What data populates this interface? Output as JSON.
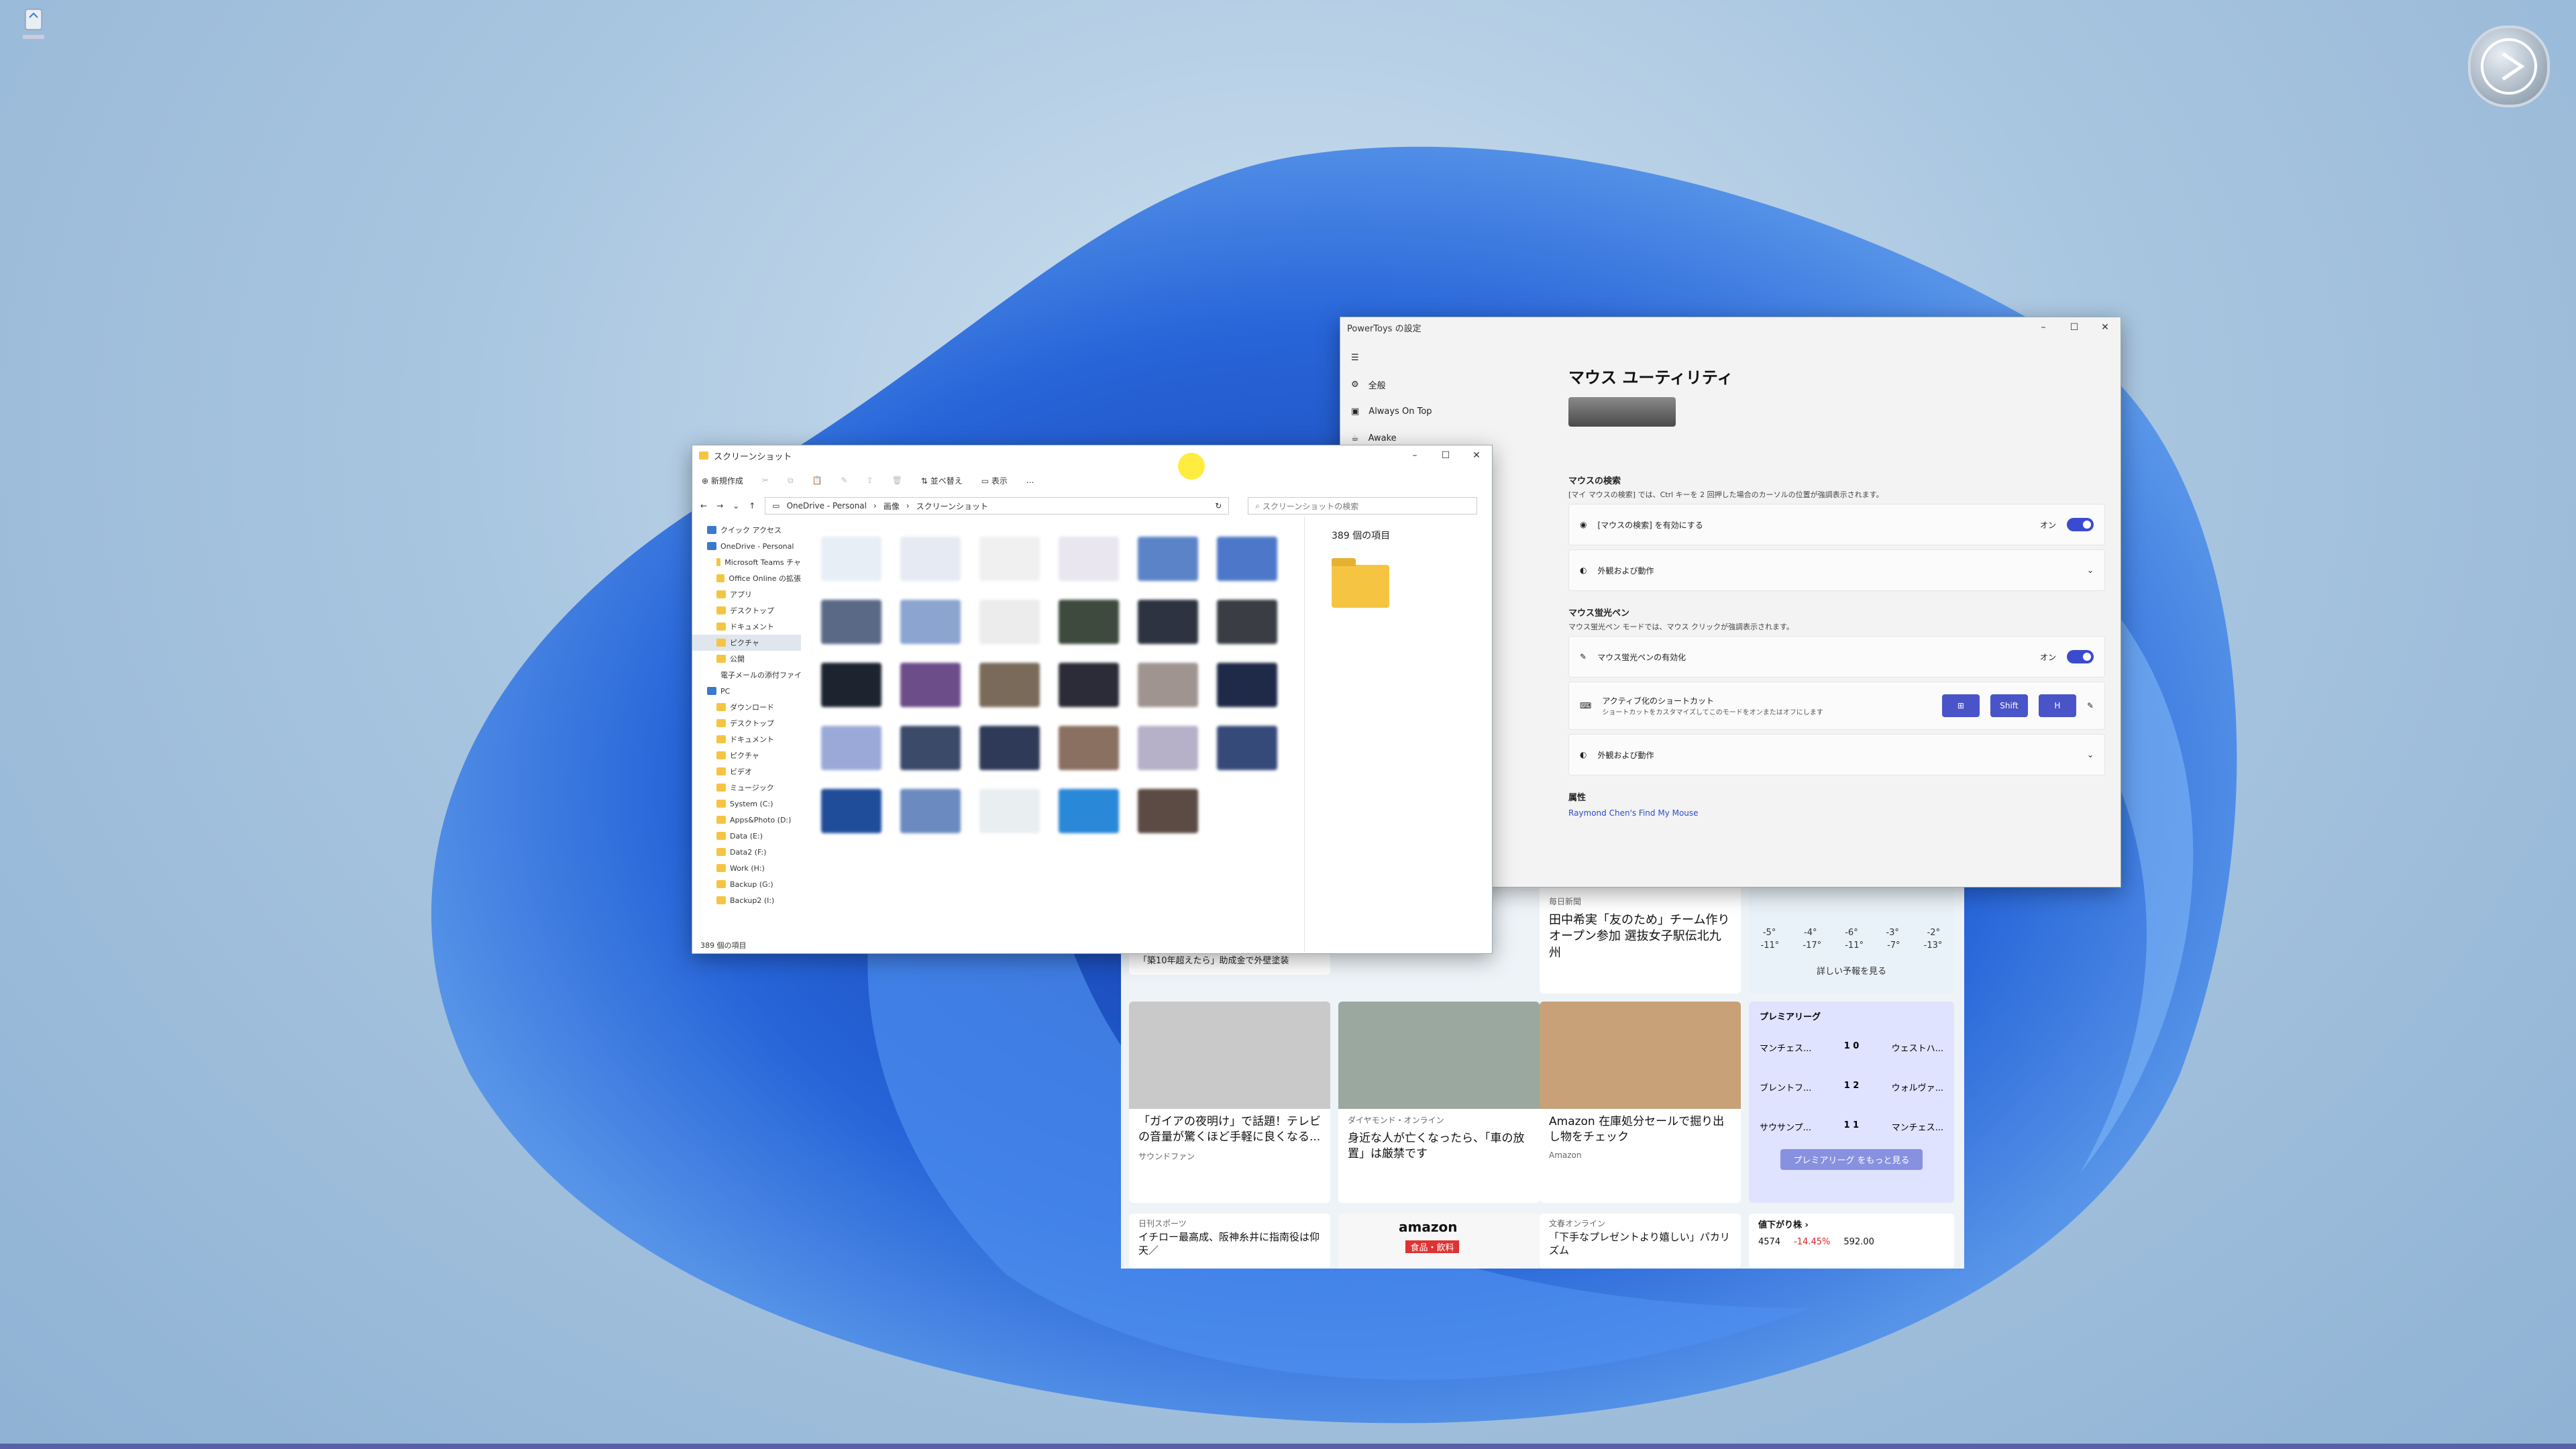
{
  "desktop": {
    "recycle_icon": "recycle-bin-icon"
  },
  "explorer": {
    "title": "スクリーンショット",
    "toolbar": {
      "new_label": "新規作成",
      "sort_label": "並べ替え",
      "view_label": "表示",
      "more_label": "..."
    },
    "breadcrumb": [
      "OneDrive - Personal",
      "画像",
      "スクリーンショット"
    ],
    "search_placeholder": "スクリーンショットの検索",
    "nav": [
      {
        "label": "クイック アクセス",
        "level": 0
      },
      {
        "label": "OneDrive - Personal",
        "level": 0
      },
      {
        "label": "Microsoft Teams チャ",
        "level": 1
      },
      {
        "label": "Office Online の拡張",
        "level": 1
      },
      {
        "label": "アプリ",
        "level": 1
      },
      {
        "label": "デスクトップ",
        "level": 1
      },
      {
        "label": "ドキュメント",
        "level": 1
      },
      {
        "label": "ピクチャ",
        "level": 1,
        "selected": true
      },
      {
        "label": "公開",
        "level": 1
      },
      {
        "label": "電子メールの添付ファイ",
        "level": 1
      },
      {
        "label": "PC",
        "level": 0
      },
      {
        "label": "ダウンロード",
        "level": 1
      },
      {
        "label": "デスクトップ",
        "level": 1
      },
      {
        "label": "ドキュメント",
        "level": 1
      },
      {
        "label": "ピクチャ",
        "level": 1
      },
      {
        "label": "ビデオ",
        "level": 1
      },
      {
        "label": "ミュージック",
        "level": 1
      },
      {
        "label": "System (C:)",
        "level": 1
      },
      {
        "label": "Apps&Photo (D:)",
        "level": 1
      },
      {
        "label": "Data (E:)",
        "level": 1
      },
      {
        "label": "Data2 (F:)",
        "level": 1
      },
      {
        "label": "Work (H:)",
        "level": 1
      },
      {
        "label": "Backup (G:)",
        "level": 1
      },
      {
        "label": "Backup2 (I:)",
        "level": 1
      }
    ],
    "item_count": "389 個の項目",
    "status_text": "389 個の項目",
    "thumb_colors": [
      "#e8eef6",
      "#e6ebf3",
      "#f0f0f0",
      "#e9e6ef",
      "#5b84c8",
      "#4d78c9",
      "#5a6a86",
      "#8ba5d0",
      "#ececec",
      "#3e4a3e",
      "#2d3340",
      "#3a3d44",
      "#1d2430",
      "#6d4c8a",
      "#7a6a5a",
      "#2c2c38",
      "#a09490",
      "#1e2a48",
      "#9ba9d8",
      "#3c4a6a",
      "#2e3a58",
      "#8a7060",
      "#b6b0c8",
      "#364a7a",
      "#1f4d9a",
      "#6a8ac0",
      "#e9eef0",
      "#2a88d8",
      "#5c4a44"
    ]
  },
  "powertoys": {
    "title": "PowerToys の設定",
    "nav": [
      {
        "label": "全般",
        "icon": "gear-icon"
      },
      {
        "label": "Always On Top",
        "icon": "window-icon"
      },
      {
        "label": "Awake",
        "icon": "coffee-icon"
      }
    ],
    "heading": "マウス ユーティリティ",
    "find_mouse": {
      "section": "マウスの検索",
      "desc": "[マイ マウスの検索] では、Ctrl キーを 2 回押した場合のカーソルの位置が強調表示されます。",
      "enable_label": "[マウスの検索] を有効にする",
      "state": "オン",
      "appearance": "外観および動作"
    },
    "highlighter": {
      "section": "マウス蛍光ペン",
      "desc": "マウス蛍光ペン モードでは、マウス クリックが強調表示されます。",
      "enable_label": "マウス蛍光ペンの有効化",
      "state": "オン",
      "shortcut_label": "アクティブ化のショートカット",
      "shortcut_desc": "ショートカットをカスタマイズしてこのモードをオンまたはオフにします",
      "keys": [
        "⊞",
        "Shift",
        "H"
      ],
      "appearance": "外観および動作"
    },
    "attribution": {
      "label": "属性",
      "link": "Raymond Chen's Find My Mouse"
    }
  },
  "news": {
    "top_left": "「築10年超えたら」助成金で外壁塗装",
    "top_mid_src": "毎日新聞",
    "top_mid": "田中希実「友のため」チーム作りオープン参加 選抜女子駅伝北九州",
    "weather": {
      "temps_high": [
        "-5°",
        "-4°",
        "-6°",
        "-3°",
        "-2°"
      ],
      "temps_low": [
        "-11°",
        "-17°",
        "-11°",
        "-7°",
        "-13°"
      ],
      "more": "詳しい予報を見る"
    },
    "cards": [
      {
        "headline": "「ガイアの夜明け」で話題！テレビの音量が驚くほど手軽に良くなる...",
        "source": "サウンドファン",
        "img": "#c9c9c9"
      },
      {
        "source": "ダイヤモンド・オンライン",
        "headline": "身近な人が亡くなったら、「車の放置」は厳禁です",
        "img": "#9aa8a0"
      },
      {
        "headline": "Amazon 在庫処分セールで掘り出し物をチェック",
        "source": "Amazon",
        "img": "#c8a178"
      }
    ],
    "premier": {
      "title": "プレミアリーグ",
      "matches": [
        {
          "home": "マンチェス...",
          "away": "ウェストハ...",
          "score": "1 0"
        },
        {
          "home": "ブレントフ...",
          "away": "ウォルヴァ...",
          "score": "1 2"
        },
        {
          "home": "サウサンプ...",
          "away": "マンチェス...",
          "score": "1 1"
        }
      ],
      "more": "プレミアリーグ をもっと見る"
    },
    "bottom": [
      {
        "source": "日刊スポーツ",
        "headline": "イチロー最高成、阪神糸井に指南役は仰天／"
      },
      {
        "headline": "amazon",
        "sub": "食品・飲料"
      },
      {
        "source": "文春オンライン",
        "headline": "「下手なプレゼントより嬉しい」パカリズム"
      },
      {
        "title": "値下がり株 ›",
        "stock": "4574",
        "change": "-14.45%",
        "price": "592.00"
      }
    ]
  }
}
